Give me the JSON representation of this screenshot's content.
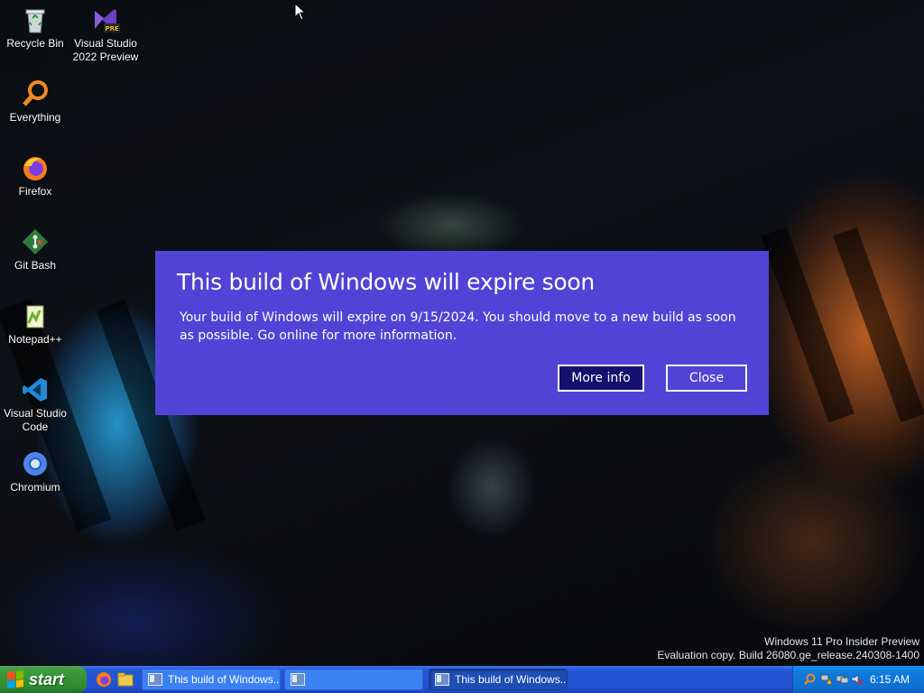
{
  "desktop": {
    "icons": [
      {
        "label": "Recycle Bin",
        "icon": "recycle-bin-icon"
      },
      {
        "label": "Visual Studio 2022 Preview",
        "icon": "visual-studio-icon",
        "badge": "PRE"
      },
      {
        "label": "Everything",
        "icon": "everything-search-icon"
      },
      {
        "label": "Firefox",
        "icon": "firefox-icon"
      },
      {
        "label": "Git Bash",
        "icon": "git-bash-icon"
      },
      {
        "label": "Notepad++",
        "icon": "notepad-plus-plus-icon"
      },
      {
        "label": "Visual Studio Code",
        "icon": "vscode-icon"
      },
      {
        "label": "Chromium",
        "icon": "chromium-icon"
      }
    ]
  },
  "dialog": {
    "title": "This build of Windows will expire soon",
    "message": "Your build of Windows will expire on 9/15/2024. You should move to a new build as soon as possible. Go online for more information.",
    "more_info_label": "More info",
    "close_label": "Close",
    "background": "#4f44d6"
  },
  "watermark": {
    "line1": "Windows 11 Pro Insider Preview",
    "line2": "Evaluation copy. Build 26080.ge_release.240308-1400"
  },
  "taskbar": {
    "start_label": "start",
    "tasks": [
      {
        "label": "This build of Windows...",
        "active": false
      },
      {
        "label": "",
        "active": false
      },
      {
        "label": "This build of Windows...",
        "active": true
      }
    ],
    "clock": "6:15 AM",
    "colors": {
      "taskbar": "#2457d6",
      "start": "#3b9a3b",
      "tray": "#0f7be0"
    }
  }
}
